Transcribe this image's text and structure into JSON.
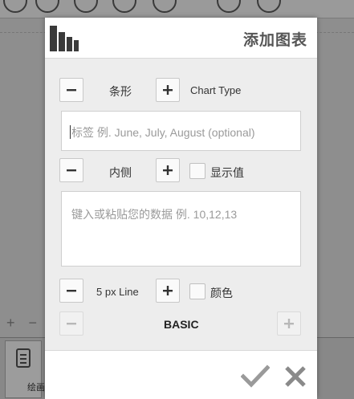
{
  "dialog": {
    "title": "添加图表",
    "chart_type": {
      "value": "条形",
      "label": "Chart Type"
    },
    "labels_input": {
      "placeholder": "标签 例. June, July, August (optional)"
    },
    "label_position": {
      "value": "内侧",
      "show_values_label": "显示值"
    },
    "data_input": {
      "placeholder": "键入或粘贴您的数据 例. 10,12,13"
    },
    "line_width": {
      "value": "5 px Line",
      "color_label": "颜色"
    },
    "theme": {
      "value": "BASIC"
    }
  },
  "background": {
    "card_label": "绘画"
  },
  "colors": {
    "accent": "#333333",
    "confirm": "#9a9a9a",
    "close": "#8a8a8a"
  }
}
